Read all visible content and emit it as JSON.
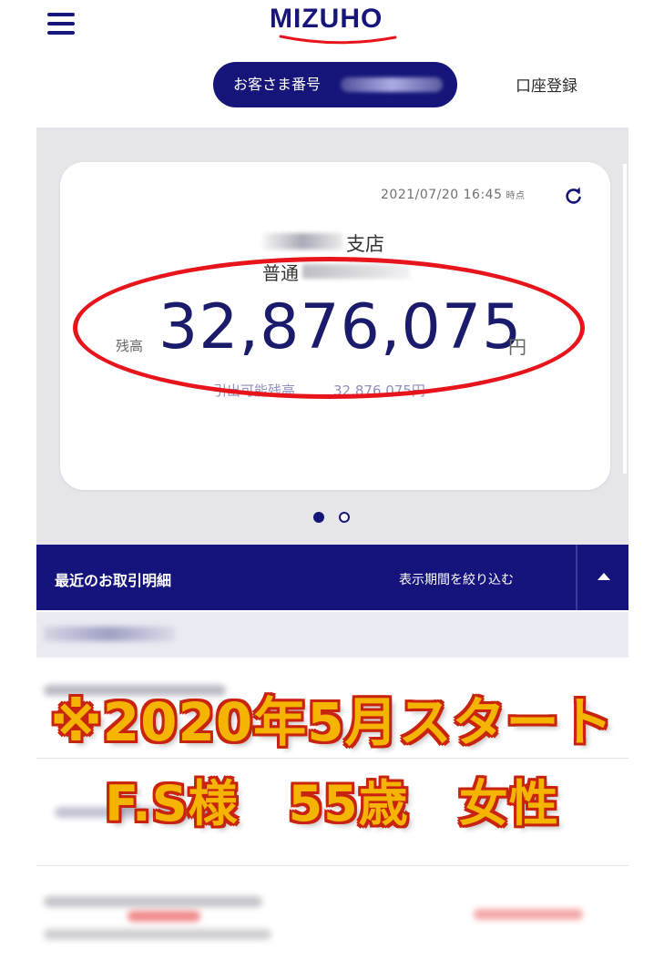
{
  "header": {
    "logo_text": "MIZUHO"
  },
  "customer": {
    "number_label": "お客さま番号"
  },
  "nav": {
    "account_registration": "口座登録"
  },
  "account_card": {
    "timestamp": "2021/07/20 16:45",
    "timestamp_suffix": "時点",
    "branch_label": "支店",
    "account_type": "普通",
    "balance_label": "残高",
    "balance_amount": "32,876,075",
    "balance_unit": "円",
    "available_label": "引出可能残高",
    "available_amount": "32,876,075円"
  },
  "carousel": {
    "active_index": 0,
    "page_count": 2
  },
  "transactions": {
    "title": "最近のお取引明細",
    "filter_label": "表示期間を絞り込む"
  },
  "overlay": {
    "line1": "※2020年5月スタート",
    "line2": "F.S様　55歳　女性"
  },
  "colors": {
    "brand_navy": "#15157a",
    "highlight_red": "#e8141b",
    "overlay_yellow": "#f5b400",
    "overlay_outline": "#c8230e"
  },
  "icons": {
    "menu": "hamburger-menu-icon",
    "refresh": "refresh-icon",
    "collapse": "chevron-up-icon"
  }
}
